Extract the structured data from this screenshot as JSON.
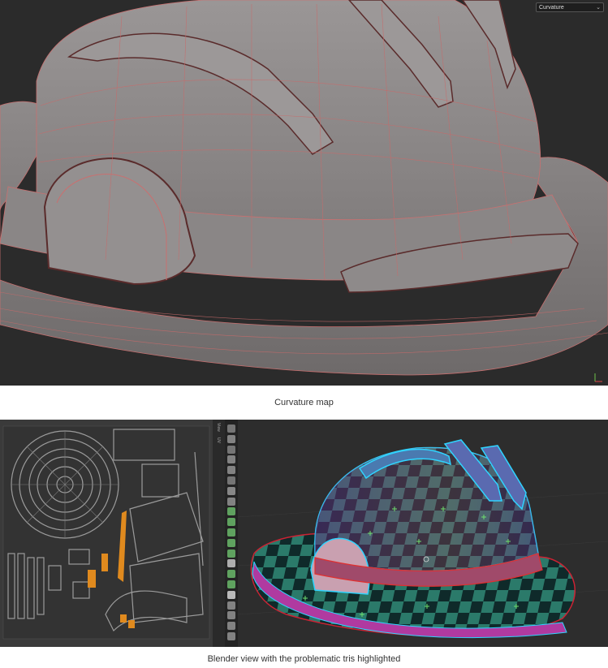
{
  "top": {
    "view_mode_dropdown": {
      "selected": "Curvature"
    },
    "caption": "Curvature map"
  },
  "bottom": {
    "uv_side_tabs": [
      "View",
      "UV"
    ],
    "tools": [
      "cursor",
      "select",
      "move",
      "rotate",
      "scale",
      "transform",
      "annotate",
      "measure",
      "add-cube",
      "extrude",
      "inset",
      "bevel",
      "loop-cut",
      "knife",
      "poly-build",
      "spin",
      "smooth",
      "edge-slide",
      "shrink-fatten",
      "shear",
      "rip-region"
    ],
    "caption": "Blender view with the problematic tris highlighted"
  },
  "colors": {
    "viewport_bg": "#2b2b2b",
    "mesh_gray": "#8c8888",
    "wire_red": "#c96a6a",
    "highlight_cyan": "#2fd4ff",
    "uv_island": "#9b9b9b",
    "uv_selected": "#e08a1e"
  }
}
